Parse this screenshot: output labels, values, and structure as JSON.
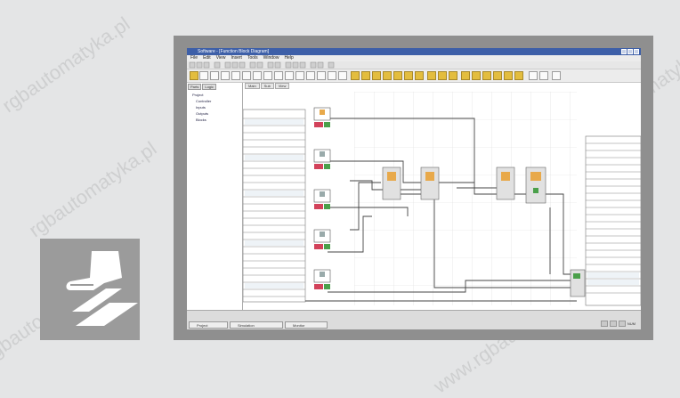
{
  "watermark": {
    "text_pl": "rgbautomatyka.pl",
    "text_www": "www.rgbautomatyka.pl"
  },
  "window": {
    "title": "Software - [Function Block Diagram]"
  },
  "menubar": {
    "items": [
      "File",
      "Edit",
      "View",
      "Insert",
      "Tools",
      "Window",
      "Help"
    ]
  },
  "side_panel": {
    "tabs": [
      "Parts",
      "Logic"
    ],
    "tree_items": [
      "Project",
      "Controller",
      "Inputs",
      "Outputs",
      "Blocks"
    ]
  },
  "canvas": {
    "tabs": [
      "Main",
      "Sub",
      "View"
    ]
  },
  "status": {
    "tabs": [
      "Project",
      "Simulation",
      "Monitor"
    ],
    "right_text": "NUM"
  },
  "icons": {
    "device": "hand-on-device-icon"
  },
  "colors": {
    "background": "#e4e5e6",
    "frame": "#8f8f8f",
    "titlebar": "#3d5fa8",
    "toolbar_gold": "#e3bd3e",
    "block_fill": "#e1e1e1",
    "block_accent": "#e8a94a",
    "input_red": "#d2425a",
    "input_green": "#4aa04a",
    "wire": "#444444"
  }
}
